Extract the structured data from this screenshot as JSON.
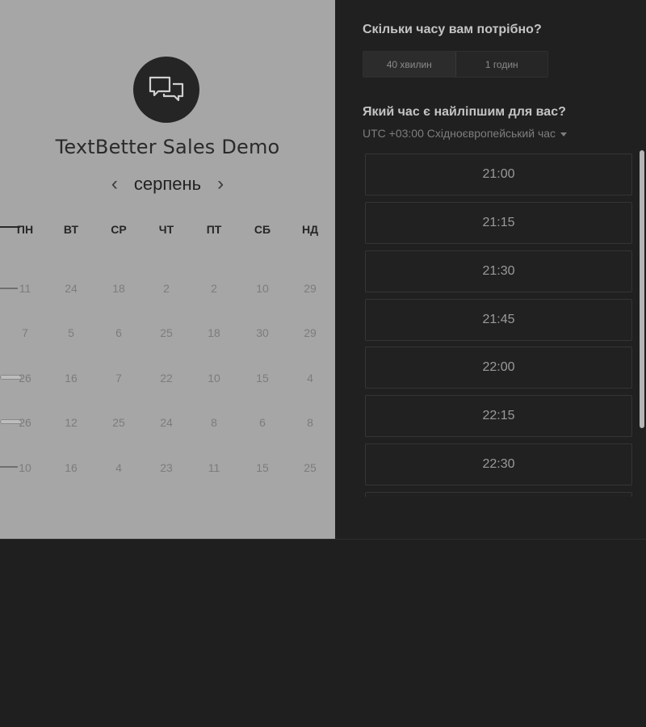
{
  "company": {
    "title": "TextBetter Sales Demo",
    "logo_icon": "chat-bubbles-icon"
  },
  "calendar": {
    "month": "серпень",
    "prev_icon": "chevron-left-icon",
    "next_icon": "chevron-right-icon",
    "weekdays": [
      "ПН",
      "ВТ",
      "СР",
      "ЧТ",
      "ПТ",
      "СБ",
      "НД"
    ],
    "rows": [
      [
        "11",
        "24",
        "18",
        "2",
        "2",
        "10",
        "29"
      ],
      [
        "7",
        "5",
        "6",
        "25",
        "18",
        "30",
        "29"
      ],
      [
        "26",
        "16",
        "7",
        "22",
        "10",
        "15",
        "4"
      ],
      [
        "26",
        "12",
        "25",
        "24",
        "8",
        "6",
        "8"
      ],
      [
        "10",
        "16",
        "4",
        "23",
        "11",
        "15",
        "25"
      ]
    ]
  },
  "duration": {
    "heading": "Скільки часу вам потрібно?",
    "options": [
      "40 хвилин",
      "1 годин"
    ]
  },
  "time": {
    "heading": "Який час є найліпшим для вас?",
    "timezone": "UTC +03:00 Східноєвропейський час",
    "slots": [
      "21:00",
      "21:15",
      "21:30",
      "21:45",
      "22:00",
      "22:15",
      "22:30",
      ""
    ]
  }
}
